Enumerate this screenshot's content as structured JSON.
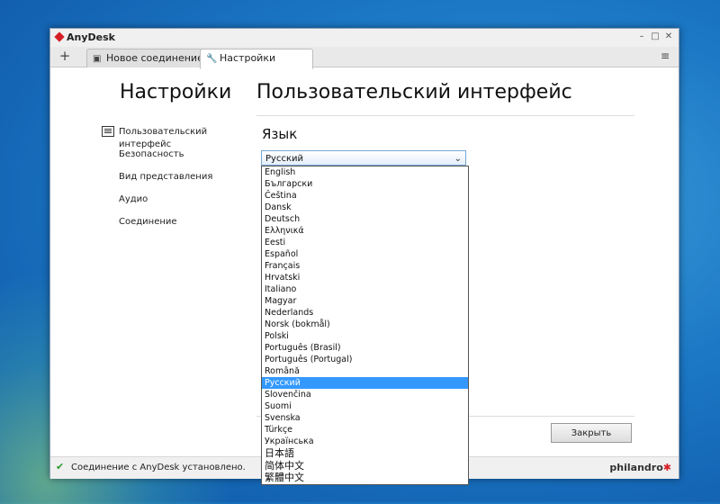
{
  "window": {
    "app_title": "AnyDesk",
    "controls": {
      "minimize": "–",
      "maximize": "□",
      "close": "✕"
    }
  },
  "tabs": [
    {
      "label": "Новое соединение",
      "icon": "monitor-icon",
      "active": false
    },
    {
      "label": "Настройки",
      "icon": "wrench-icon",
      "active": true
    }
  ],
  "tabbar": {
    "add_label": "+",
    "menu_label": "≡"
  },
  "page": {
    "settings_title": "Настройки",
    "section_title": "Пользовательский интерфейс"
  },
  "nav": [
    {
      "label": "Пользовательский интерфейс",
      "active": true
    },
    {
      "label": "Безопасность",
      "active": false
    },
    {
      "label": "Вид представления",
      "active": false
    },
    {
      "label": "Аудио",
      "active": false
    },
    {
      "label": "Соединение",
      "active": false
    }
  ],
  "language": {
    "heading": "Язык",
    "selected": "Русский",
    "options": [
      "English",
      "Български",
      "Čeština",
      "Dansk",
      "Deutsch",
      "Ελληνικά",
      "Eesti",
      "Español",
      "Français",
      "Hrvatski",
      "Italiano",
      "Magyar",
      "Nederlands",
      "Norsk (bokmål)",
      "Polski",
      "Português (Brasil)",
      "Português (Portugal)",
      "Română",
      "Русский",
      "Slovenčina",
      "Suomi",
      "Svenska",
      "Türkçe",
      "Українська",
      "日本語",
      "简体中文",
      "繁體中文"
    ]
  },
  "footer": {
    "close_label": "Закрыть"
  },
  "status": {
    "text": "Соединение с AnyDesk установлено.",
    "brand": "philandro",
    "brand_mark": "✱"
  },
  "colors": {
    "accent_red": "#d51f26",
    "selection_blue": "#3399ff",
    "desktop_blue": "#1c78c5"
  }
}
